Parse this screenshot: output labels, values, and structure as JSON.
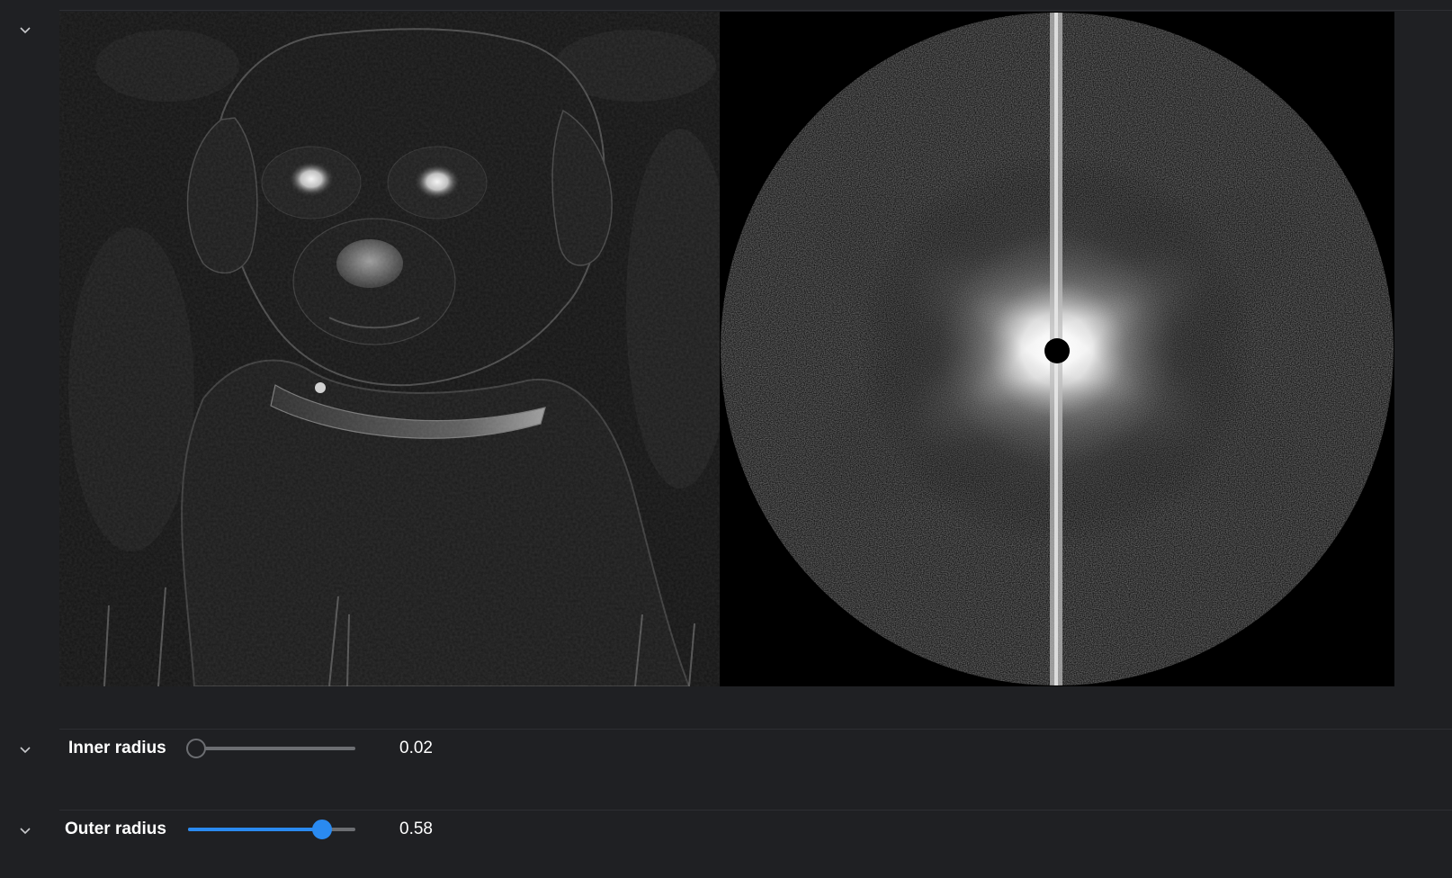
{
  "icons": {
    "collapse": "chevron-down-icon"
  },
  "images": {
    "left_panel": "filtered-puppy-image",
    "right_panel": "fourier-spectrum-image"
  },
  "controls": {
    "inner_radius": {
      "label": "Inner radius",
      "value": "0.02",
      "fraction": 0.02
    },
    "outer_radius": {
      "label": "Outer radius",
      "value": "0.58",
      "fraction": 0.8
    }
  },
  "colors": {
    "background": "#1f2023",
    "accent": "#2a8af0",
    "track": "#6c6e72",
    "text": "#ffffff"
  }
}
